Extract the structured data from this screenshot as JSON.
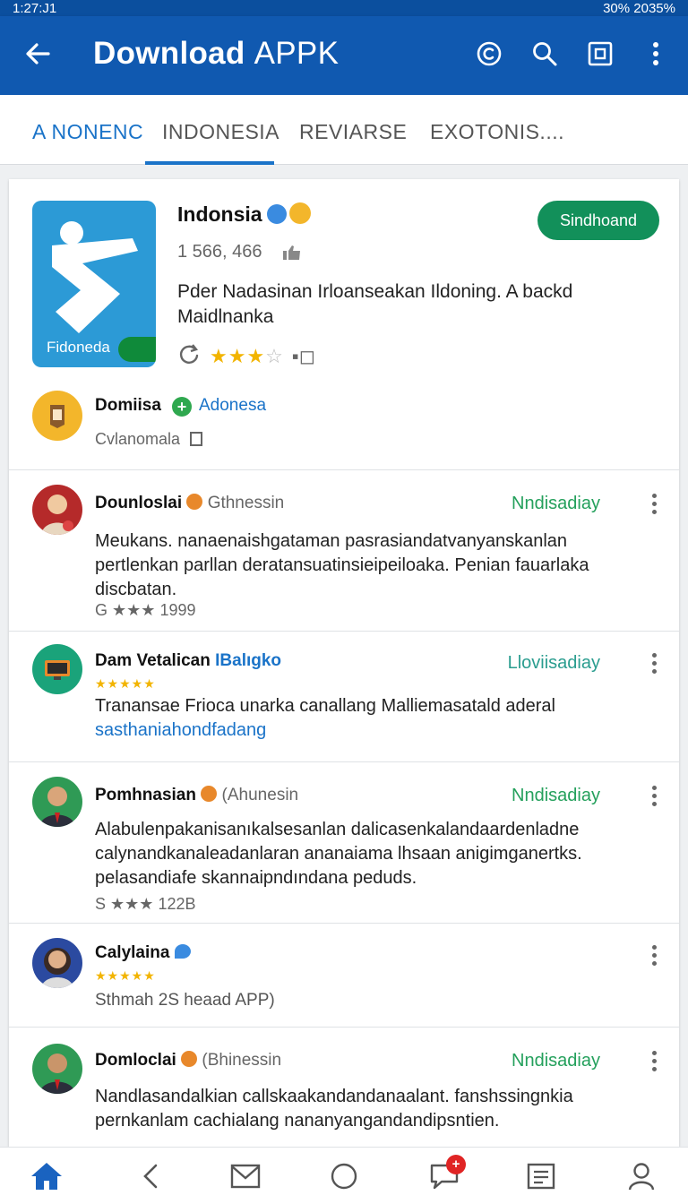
{
  "status_bar": {
    "left": "1:27:J1",
    "right": "30% 2035%"
  },
  "app_bar": {
    "title": "Download APPK",
    "title_bold": "Download",
    "title_rest": "APPK"
  },
  "tabs": [
    {
      "label": "A NONENC",
      "active": true
    },
    {
      "label": "INDONESIA",
      "active": false
    },
    {
      "label": "REVIARSE",
      "active": false
    },
    {
      "label": "EXOTONIS....",
      "active": false
    }
  ],
  "app": {
    "name": "Indonsia",
    "icon_label": "Fidoneda",
    "downloads": "1 566, 466",
    "description": "Pder Nadasinan Irloanseakan Ildoning.  A backd Maidlnanka",
    "rating_stars": 3,
    "install_label": "Sindhoand"
  },
  "developer": {
    "name": "Domiisa",
    "link": "Adonesa",
    "sub": "Cvlanomala"
  },
  "reviews": [
    {
      "name": "Dounloslai",
      "handle": "Gthnessin",
      "tag": "Nndisadiay",
      "text": "Meukans. nanaenaishgataman pasrasiandatvanyanskanlan pertlenkan parllan deratansuatinsieipeiloaka. Penian fauarlaka discbatan.",
      "meta": "★★★ 1999",
      "meta_prefix": "G"
    },
    {
      "name": "Dam Vetalican",
      "handle": "IBalıgko",
      "tag": "Lloviisadiay",
      "stars": "★★★★★",
      "text_main": "Tranansae Frioca unarka  canallang Malliemasatald aderal",
      "text_link": "sasthaniahondfadang"
    },
    {
      "name": "Pomhnasian",
      "handle": "(Ahunesin",
      "tag": "Nndisadiay",
      "text": "Alabulenpakanisanıkalsesanlan dalicasenkalandaardenladne calynandkanaleadanlaran ananaiama lhsaan anigimganertks. pelasandiafe skannaipndındana peduds.",
      "meta": "★★★ 122B",
      "meta_prefix": "S"
    },
    {
      "name": "Calylaina",
      "stars": "★★★★★",
      "text": "Sthmah  2S heaad APP)"
    },
    {
      "name": "Domloclai",
      "handle": "(Bhinessin",
      "tag": "Nndisadiay",
      "text": "Nandlasandalkian callskaakandandanaalant. fanshssingnkia pernkanlam cachialang nananyangandandipsntien."
    }
  ],
  "nav": {
    "badge": "+"
  },
  "colors": {
    "primary": "#1059b0",
    "accent": "#1a73c8",
    "install": "#12905a",
    "tag_green": "#24a05c",
    "star": "#f2b400"
  }
}
